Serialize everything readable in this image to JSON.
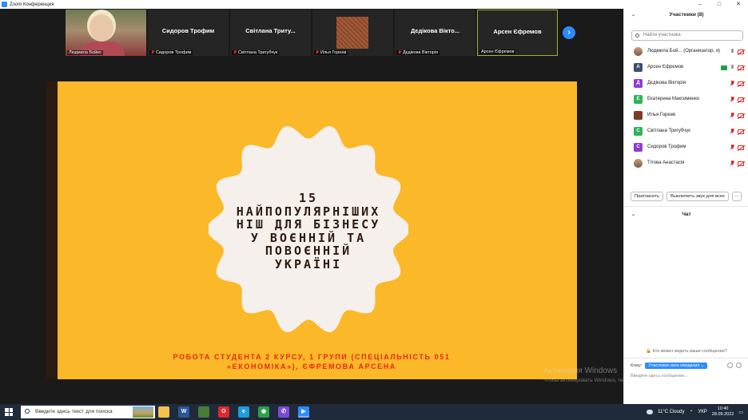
{
  "window": {
    "title": "Zoom Конференция",
    "controls": [
      "–",
      "□",
      "✕"
    ]
  },
  "thumbnails": [
    {
      "label": "Людмила Бойко",
      "type": "photo",
      "muted": false
    },
    {
      "center_name": "Сидоров Трофим",
      "label": "Сидоров Трофим",
      "muted": true
    },
    {
      "center_name": "Світлана  Триту...",
      "label": "Світлана Тригубчук",
      "muted": true
    },
    {
      "label": "Илья Гореев",
      "type": "image",
      "muted": true
    },
    {
      "center_name": "Дєдікова Вікто...",
      "label": "Дєдікова Вікторія",
      "muted": true
    },
    {
      "center_name": "Арсен Єфремов",
      "label": "Арсен Єфремов",
      "muted": false,
      "active": true
    }
  ],
  "next_icon": "chevron-right-icon",
  "slide": {
    "title_lines": [
      "15",
      "НАЙПОПУЛЯРНІШИХ",
      "НІШ ДЛЯ БІЗНЕСУ",
      "У ВОЄННІЙ ТА",
      "ПОВОЄННІЙ",
      "УКРАЇНІ"
    ],
    "subtitle_lines": [
      "РОБОТА СТУДЕНТА 2 КУРСУ, 1 ГРУПИ (СПЕЦІАЛЬНІСТЬ 051",
      "«ЕКОНОМІКА»), ЄФРЕМОВА АРСЕНА"
    ],
    "background_color": "#fbb828",
    "title_color": "#2c1a10",
    "subtitle_color": "#e8271c"
  },
  "watermark": {
    "line1": "Активация Windows",
    "line2": "Чтобы активировать Windows, перейдите в раздел \"Параметры\"."
  },
  "participants_panel": {
    "header": "Участники (8)",
    "search_placeholder": "Найти участника",
    "participants": [
      {
        "initial": "",
        "avatar_color": "",
        "name": "Людмила Бой... (Организатор, я)",
        "photo": true,
        "share": false,
        "mic_off": false,
        "cam_off": true
      },
      {
        "initial": "А",
        "avatar_color": "#3b4f6b",
        "name": "Арсен Єфремов",
        "share": true,
        "mic_off": false,
        "cam_off": true
      },
      {
        "initial": "Д",
        "avatar_color": "#8e3bd1",
        "name": "Дєдікова Вікторія",
        "mic_off": true,
        "cam_off": true
      },
      {
        "initial": "Е",
        "avatar_color": "#2fb35a",
        "name": "Екатерина Максименко",
        "mic_off": true,
        "cam_off": true
      },
      {
        "initial": "",
        "avatar_color": "#7a3b2a",
        "name": "Илья Гореев",
        "mic_off": true,
        "cam_off": true
      },
      {
        "initial": "С",
        "avatar_color": "#2fb35a",
        "name": "Світлана Тригубчук",
        "mic_off": true,
        "cam_off": true
      },
      {
        "initial": "С",
        "avatar_color": "#8e3bd1",
        "name": "Сидоров Трофим",
        "mic_off": true,
        "cam_off": true
      },
      {
        "initial": "",
        "avatar_color": "",
        "name": "Тітова Анастасія",
        "photo": true,
        "mic_off": true,
        "cam_off": true
      }
    ],
    "invite_label": "Пригласить",
    "mute_all_label": "Выключить звук для всех",
    "more_label": "···"
  },
  "chat": {
    "header": "Чат",
    "note": "Кто может видеть ваши сообщения?",
    "to_label": "Кому:",
    "to_value": "Участники зала ожидания ⌄",
    "input_placeholder": "Введите здесь сообщение..."
  },
  "taskbar": {
    "search_placeholder": "Введите здесь текст для поиска",
    "apps": [
      {
        "name": "file-explorer-icon",
        "glyph": "",
        "color": "#f2c14e"
      },
      {
        "name": "word-icon",
        "glyph": "W",
        "color": "#2b579a"
      },
      {
        "name": "store-icon",
        "glyph": "",
        "color": "#4a7a3a"
      },
      {
        "name": "opera-icon",
        "glyph": "O",
        "color": "#e0282e"
      },
      {
        "name": "edge-icon",
        "glyph": "e",
        "color": "#1f9dd9"
      },
      {
        "name": "chrome-icon",
        "glyph": "◉",
        "color": "#2f9e4b"
      },
      {
        "name": "viber-icon",
        "glyph": "✆",
        "color": "#7d4ad8"
      },
      {
        "name": "zoom-icon",
        "glyph": "▶",
        "color": "#2d8cff"
      }
    ],
    "weather": "11°C  Cloudy",
    "language": "УКР",
    "time": "10:40",
    "date": "28.09.2022"
  }
}
